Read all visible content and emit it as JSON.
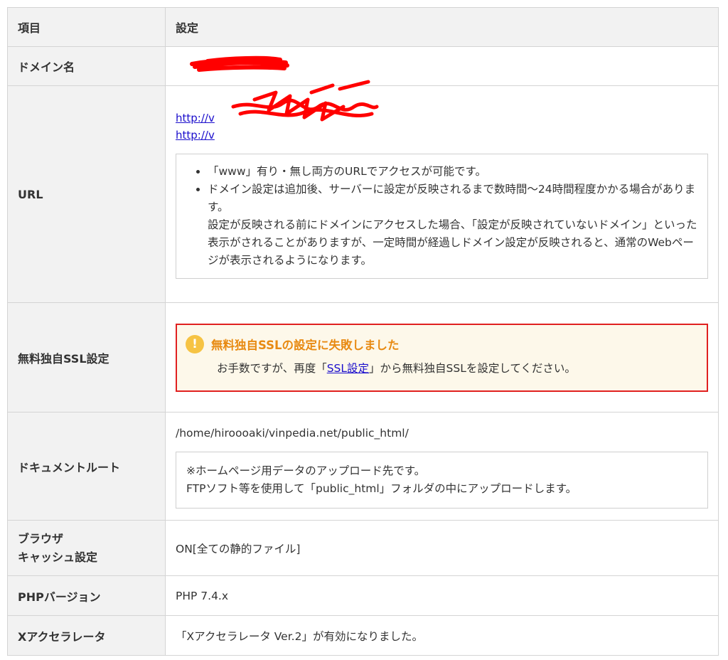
{
  "header": {
    "col1": "項目",
    "col2": "設定"
  },
  "rows": {
    "domain": {
      "label": "ドメイン名"
    },
    "url": {
      "label": "URL",
      "link1": "http://v",
      "link2": "http://v",
      "notes": [
        "「www」有り・無し両方のURLでアクセスが可能です。",
        "ドメイン設定は追加後、サーバーに設定が反映されるまで数時間〜24時間程度かかる場合があります。",
        "設定が反映される前にドメインにアクセスした場合、「設定が反映されていないドメイン」といった表示がされることがありますが、一定時間が経過しドメイン設定が反映されると、通常のWebページが表示されるようになります。"
      ]
    },
    "ssl": {
      "label": "無料独自SSL設定",
      "title": "無料独自SSLの設定に失敗しました",
      "icon": "exclamation-icon",
      "msg_before": "お手数ですが、再度「",
      "link": "SSL設定",
      "msg_after": "」から無料独自SSLを設定してください。"
    },
    "docroot": {
      "label": "ドキュメントルート",
      "path": "/home/hiroooaki/vinpedia.net/public_html/",
      "note1": "※ホームページ用データのアップロード先です。",
      "note2": "FTPソフト等を使用して「public_html」フォルダの中にアップロードします。"
    },
    "cache": {
      "label_line1": "ブラウザ",
      "label_line2": "キャッシュ設定",
      "value": "ON[全ての静的ファイル]"
    },
    "php": {
      "label": "PHPバージョン",
      "value": "PHP 7.4.x"
    },
    "xaccel": {
      "label": "Xアクセラレータ",
      "value": "「Xアクセラレータ Ver.2」が有効になりました。"
    }
  },
  "colors": {
    "warning_border": "#e02020",
    "warning_title": "#e88a12",
    "warning_bg": "#fdf8ea",
    "link": "#1a0dcc",
    "redaction": "#ff0000"
  }
}
